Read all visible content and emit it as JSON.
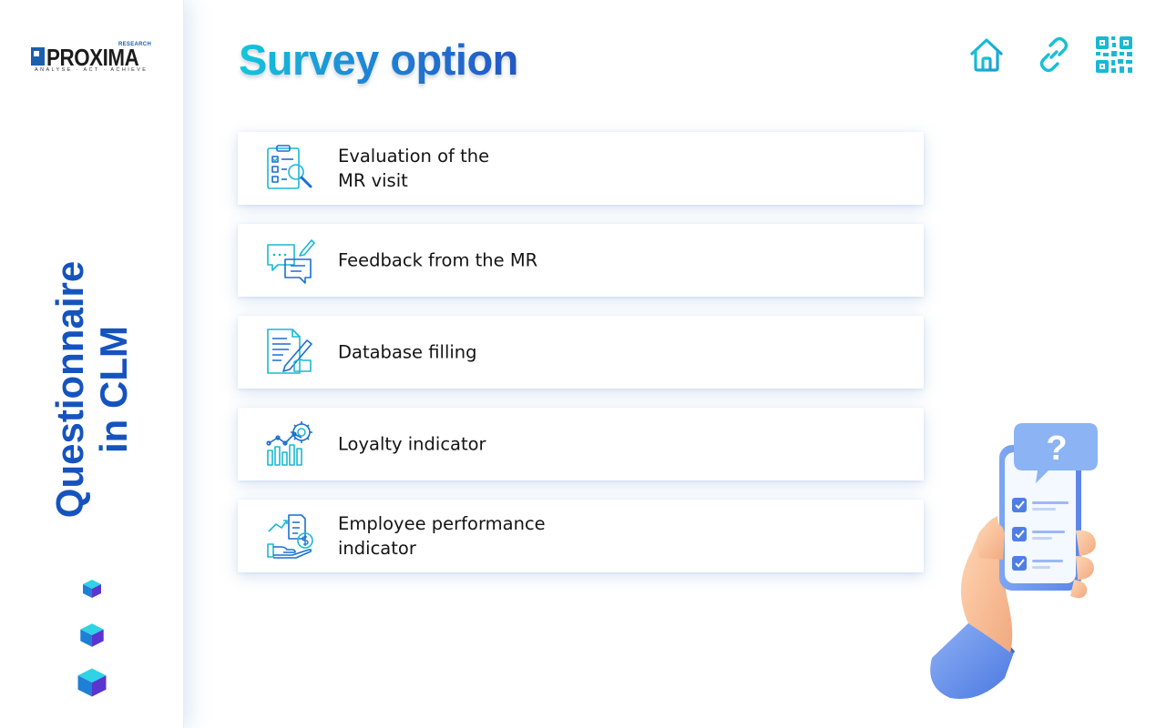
{
  "brand": {
    "name": "PROXIMA",
    "superscript": "RESEARCH",
    "tagline": "ANALYSE · ACT · ACHIEVE"
  },
  "sidebar": {
    "vertical_title_line1": "Questionnaire",
    "vertical_title_line2": "in CLM"
  },
  "header": {
    "title": "Survey option",
    "toolbar": [
      {
        "icon": "home-icon"
      },
      {
        "icon": "link-icon"
      },
      {
        "icon": "qr-code-icon"
      }
    ]
  },
  "options": [
    {
      "label": "Evaluation of the\nMR visit",
      "icon": "clipboard-search-icon"
    },
    {
      "label": "Feedback from the MR",
      "icon": "chat-feedback-icon"
    },
    {
      "label": "Database filling",
      "icon": "document-edit-icon"
    },
    {
      "label": "Loyalty indicator",
      "icon": "chart-gear-icon"
    },
    {
      "label": "Employee performance\nindicator",
      "icon": "hand-money-icon"
    }
  ],
  "colors": {
    "accent_blue": "#1553bf",
    "icon_cyan": "#19b8d4",
    "title_gradient_start": "#12c7dc",
    "title_gradient_end": "#2456c6"
  }
}
